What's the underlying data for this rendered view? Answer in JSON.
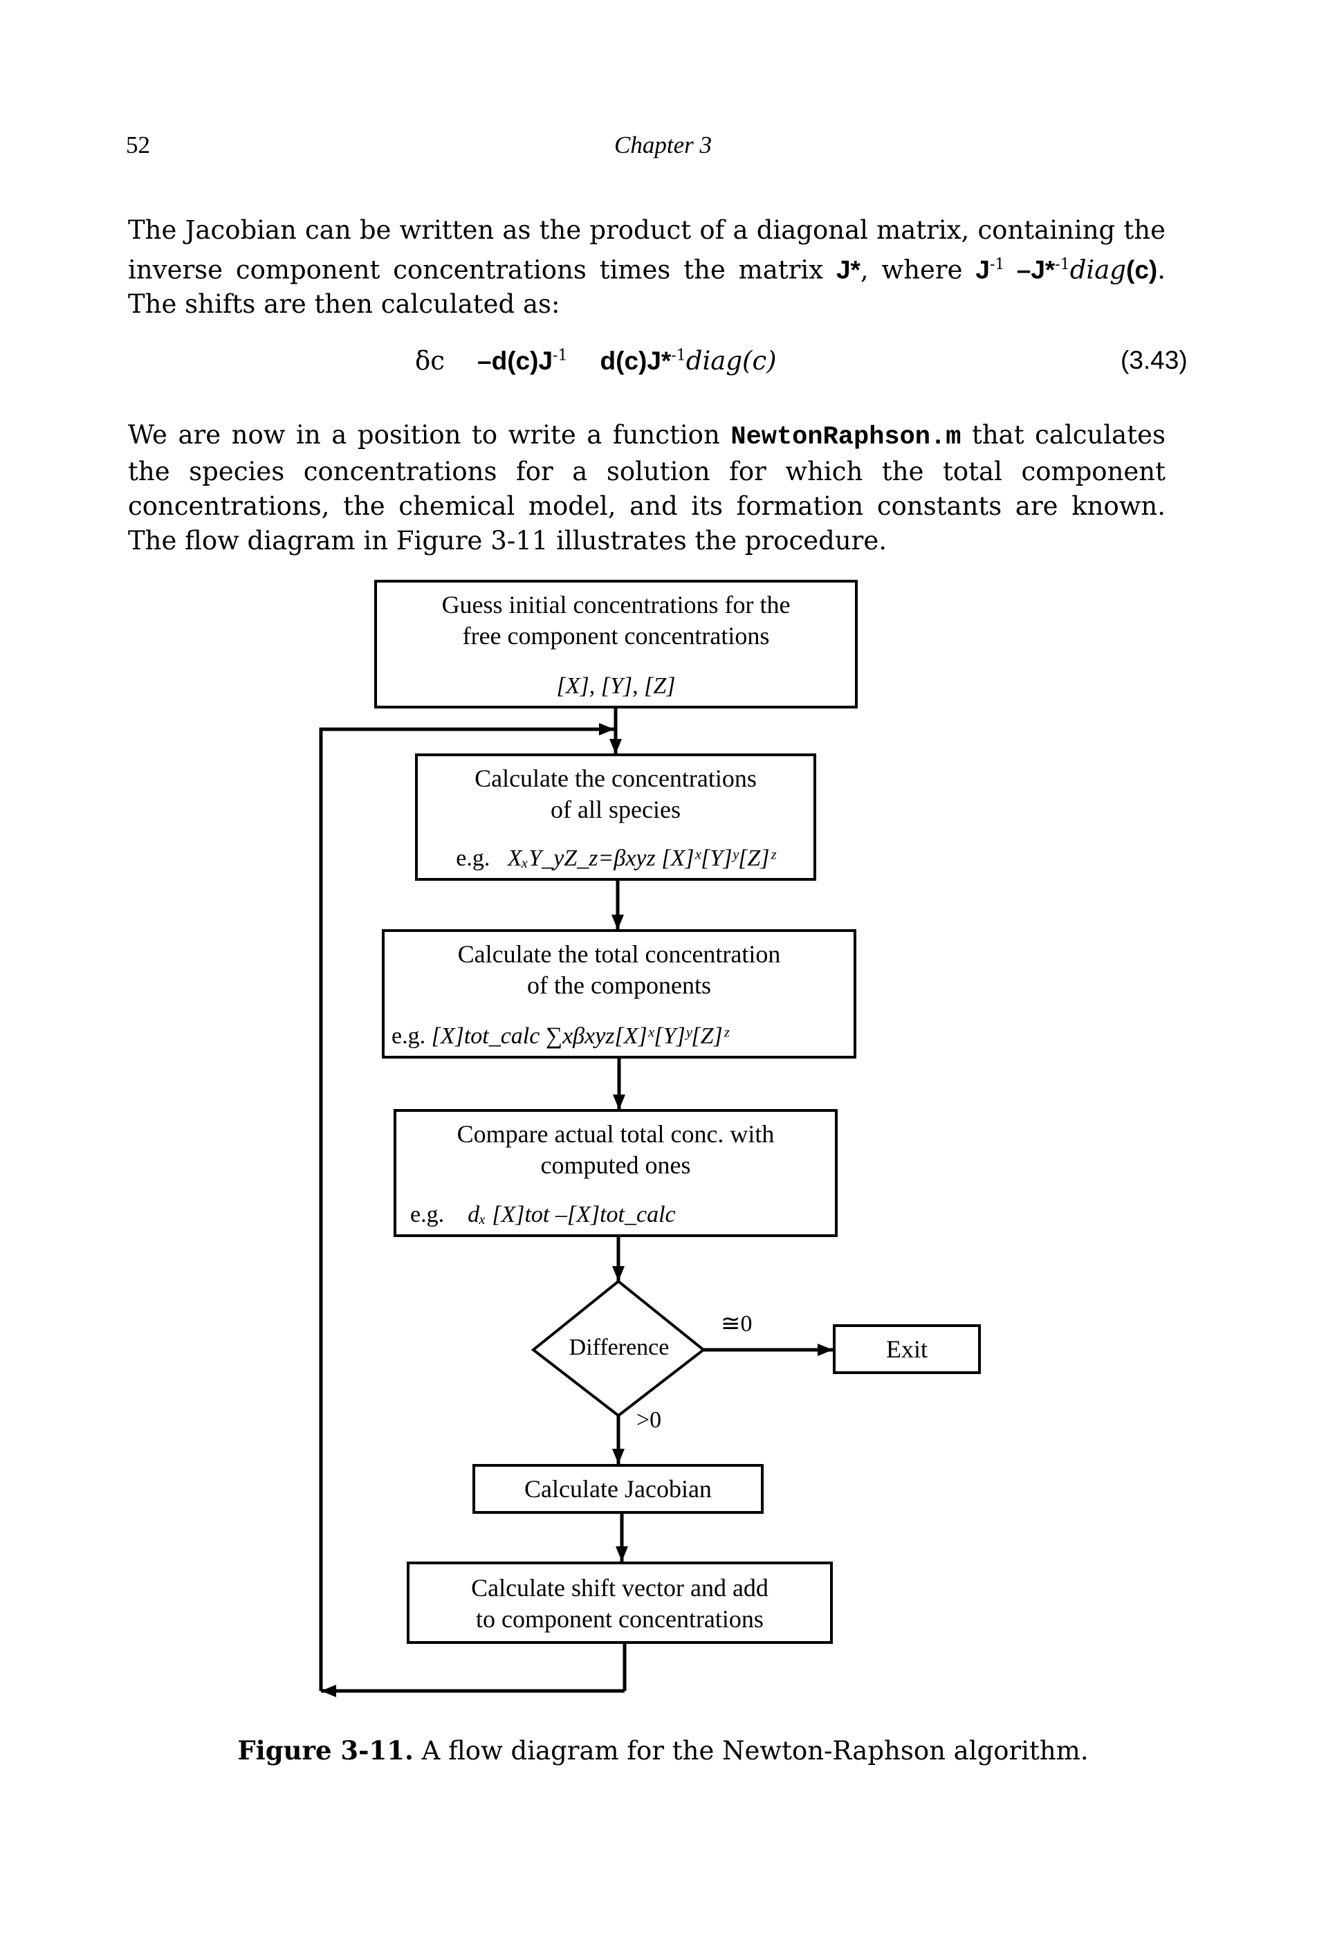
{
  "header": {
    "page_number": "52",
    "running_head": "Chapter 3"
  },
  "para1": {
    "text_a": "The Jacobian can be written as the product of a diagonal matrix, containing the inverse component concentrations times the matrix ",
    "J_star": "J*",
    "text_b": ", where ",
    "J_inv": "J",
    "sup_inv": "-1",
    "eq_mid": " –J*",
    "sup_star_inv": "-1",
    "diag": "diag",
    "c": "(c)",
    "text_c": ". The shifts are then calculated as:"
  },
  "equation": {
    "lhs": "δc",
    "term1": "–d(c)J",
    "term1_sup": "-1",
    "term2": "d(c)J*",
    "term2_sup": "-1",
    "term3": "diag(c)",
    "number": "(3.43)"
  },
  "para2": {
    "text_a": "We are now in a position to write a function ",
    "code": "NewtonRaphson.m",
    "text_b": " that calculates the species concentrations for a solution for which the total component concentrations, the chemical model, and its formation constants are known. The flow diagram in Figure 3-11 illustrates the procedure."
  },
  "flow": {
    "guess": {
      "line1": "Guess initial concentrations for the",
      "line2": "free component concentrations",
      "example": "[X], [Y], [Z]"
    },
    "species": {
      "line1": "Calculate the concentrations",
      "line2": "of all species",
      "eg": "e.g.",
      "example": "XₓY_yZ_z=βxyz [X]ˣ[Y]ʸ[Z]ᶻ"
    },
    "total": {
      "line1": "Calculate the total concentration",
      "line2": "of the components",
      "eg": "e.g.",
      "example": "[X]tot_calc  ∑xβxyz[X]ˣ[Y]ʸ[Z]ᶻ"
    },
    "compare": {
      "line1": "Compare actual total conc. with",
      "line2": "computed ones",
      "eg": "e.g.",
      "example": "dₓ   [X]tot –[X]tot_calc"
    },
    "decision": {
      "label": "Difference",
      "branch_exit": "≅0",
      "branch_continue": ">0"
    },
    "exit": {
      "label": "Exit"
    },
    "jacobian": {
      "label": "Calculate Jacobian"
    },
    "shift": {
      "line1": "Calculate shift vector and add",
      "line2": "to component concentrations"
    }
  },
  "caption": {
    "label": "Figure 3-11.",
    "text": " A flow diagram for the Newton-Raphson algorithm."
  }
}
